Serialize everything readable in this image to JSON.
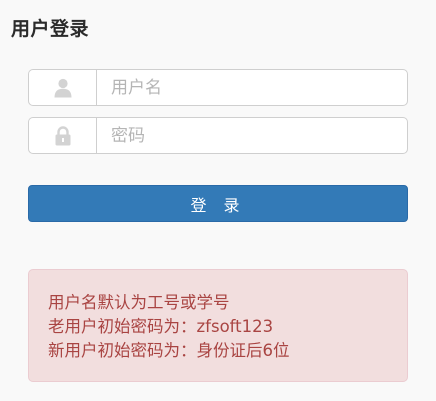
{
  "page": {
    "title": "用户登录"
  },
  "username": {
    "icon": "user-icon",
    "placeholder": "用户名"
  },
  "password": {
    "icon": "lock-icon",
    "placeholder": "密码"
  },
  "login_button": {
    "label": "登 录",
    "color": "#337ab7"
  },
  "notice": {
    "lines": [
      "用户名默认为工号或学号",
      "老用户初始密码为：zfsoft123",
      "新用户初始密码为：身份证后6位"
    ],
    "background": "#f2dede",
    "text_color": "#a94442"
  }
}
